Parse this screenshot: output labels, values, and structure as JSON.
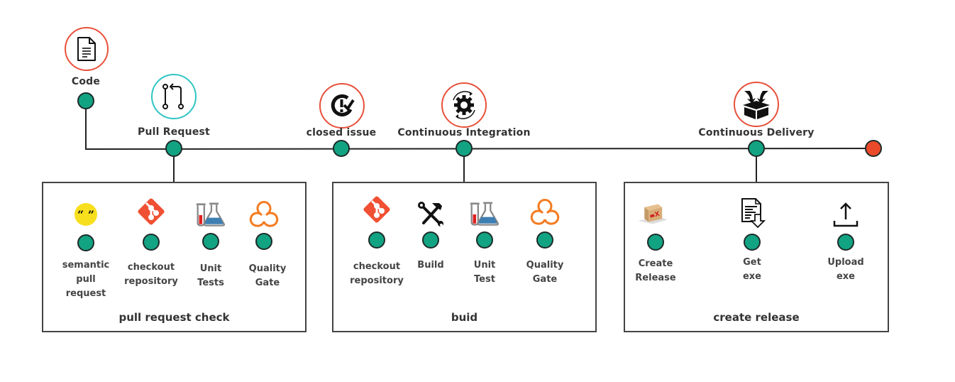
{
  "colors": {
    "node": "#12a383",
    "end_node": "#ea4a2a",
    "ring_orange": "#e8503a",
    "ring_teal": "#2ec4c4",
    "git": "#f05033",
    "quality_gate": "#f47b20",
    "semantic": "#f7df1e"
  },
  "stages": [
    {
      "id": "code",
      "label": "Code",
      "icon": "document-icon"
    },
    {
      "id": "pull-request",
      "label": "Pull Request",
      "icon": "pull-request-icon"
    },
    {
      "id": "closed-issue",
      "label": "closed issue",
      "icon": "issue-closed-icon"
    },
    {
      "id": "continuous-integration",
      "label": "Continuous Integration",
      "icon": "gear-cycle-icon"
    },
    {
      "id": "continuous-delivery",
      "label": "Continuous Delivery",
      "icon": "box-delivery-icon"
    }
  ],
  "groups": [
    {
      "title": "pull request check",
      "steps": [
        {
          "label": "semantic\npull\nrequest",
          "icon": "quote-icon"
        },
        {
          "label": "checkout\nrepository",
          "icon": "git-icon"
        },
        {
          "label": "Unit\nTests",
          "icon": "lab-flask-icon"
        },
        {
          "label": "Quality\nGate",
          "icon": "quality-gate-icon"
        }
      ]
    },
    {
      "title": "buid",
      "steps": [
        {
          "label": "checkout\nrepository",
          "icon": "git-icon"
        },
        {
          "label": "Build",
          "icon": "tools-icon"
        },
        {
          "label": "Unit\nTest",
          "icon": "lab-flask-icon"
        },
        {
          "label": "Quality\nGate",
          "icon": "quality-gate-icon"
        }
      ]
    },
    {
      "title": "create release",
      "steps": [
        {
          "label": "Create\nRelease",
          "icon": "package-icon"
        },
        {
          "label": "Get\nexe",
          "icon": "file-download-icon"
        },
        {
          "label": "Upload\nexe",
          "icon": "upload-icon"
        }
      ]
    }
  ]
}
